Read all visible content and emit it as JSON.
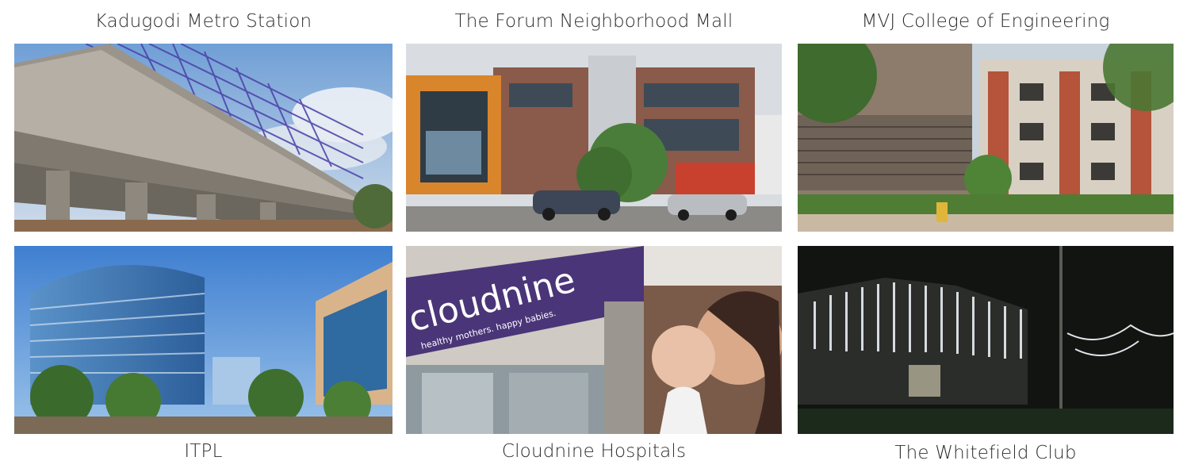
{
  "landmarks": [
    {
      "caption": "Kadugodi Metro Station"
    },
    {
      "caption": "The Forum Neighborhood Mall"
    },
    {
      "caption": "MVJ College of Engineering"
    },
    {
      "caption": "ITPL"
    },
    {
      "caption": "Cloudnine Hospitals"
    },
    {
      "caption": "The Whitefield Club"
    }
  ],
  "signage": {
    "cloudnine_logo": "cloudnine",
    "cloudnine_tagline": "healthy mothers. happy babies."
  },
  "colors": {
    "caption_text": "#2e2e2e",
    "background": "#ffffff"
  }
}
